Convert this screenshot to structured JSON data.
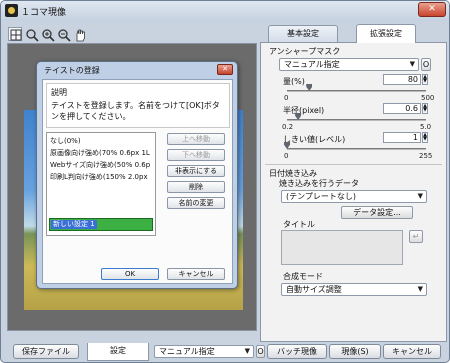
{
  "window": {
    "title": "１コマ現像",
    "close_glyph": "✕"
  },
  "toolbar": {
    "icons": [
      "fit-view-icon",
      "zoom-icon",
      "zoom-in-icon",
      "zoom-out-icon",
      "hand-icon"
    ]
  },
  "tabs": {
    "basic": "基本設定",
    "extended": "拡張設定"
  },
  "sharpen": {
    "group": "アンシャープマスク",
    "preset_value": "マニュアル指定",
    "checkbox_label": "O",
    "amount_label": "量(%)",
    "amount_value": "80",
    "amount_min": "0",
    "amount_max": "500",
    "amount_position": 0.16,
    "radius_label": "半径(pixel)",
    "radius_value": "0.6",
    "radius_min": "0.2",
    "radius_max": "5.0",
    "radius_position": 0.08,
    "threshold_label": "しきい値(レベル)",
    "threshold_value": "1",
    "threshold_min": "0",
    "threshold_max": "255",
    "threshold_position": 0.0
  },
  "date": {
    "group": "日付焼き込み",
    "data_label": "焼き込みを行うデータ",
    "template_value": "(テンプレートなし)",
    "data_settings_button": "データ設定...",
    "title_label": "タイトル",
    "enter_glyph": "↵"
  },
  "composite": {
    "label": "合成モード",
    "value": "自動サイズ調整"
  },
  "bottom": {
    "save_file": "保存ファイル",
    "settings_tab": "設定",
    "preset_value": "マニュアル指定",
    "preset_checkbox": "O",
    "batch": "バッチ現像",
    "develop": "現像(S)",
    "cancel": "キャンセル"
  },
  "dialog": {
    "title": "テイストの登録",
    "close_glyph": "✕",
    "desc_title": "説明",
    "desc_text": "テイストを登録します。名前をつけて[OK]ボタンを押してください。",
    "list_items": [
      "なし(0%)",
      "原画像向け強め(70% 0.6px 1L",
      "Webサイズ向け強め(50% 0.6p",
      "印刷L判向け強め(150% 2.0px"
    ],
    "edit_value": "新しい設定 1",
    "move_up": "上へ移動",
    "move_down": "下へ移動",
    "hide": "非表示にする",
    "delete": "削除",
    "rename": "名前の変更",
    "ok": "OK",
    "cancel": "キャンセル"
  }
}
